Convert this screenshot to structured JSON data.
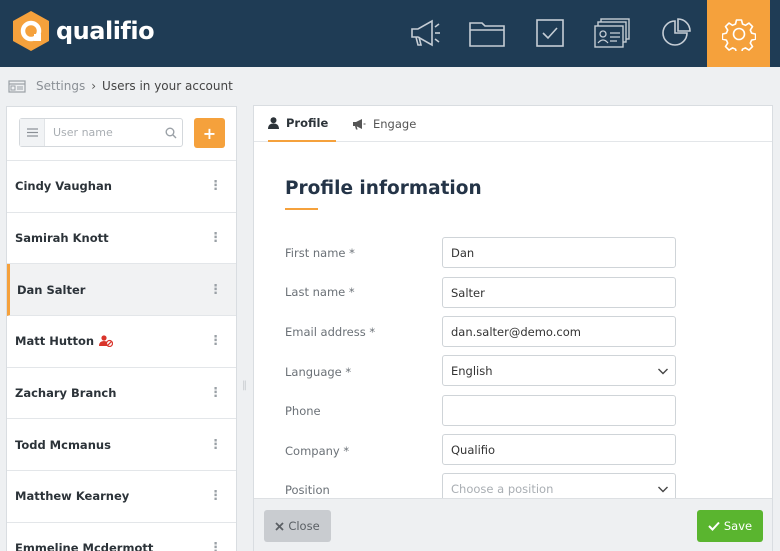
{
  "header": {
    "brand": "qualifio",
    "nav_icons": [
      "megaphone-icon",
      "folder-icon",
      "checkbox-icon",
      "contacts-icon",
      "pie-chart-icon",
      "gear-icon"
    ],
    "accent_color": "#f5a13c",
    "bar_color": "#1f3c55"
  },
  "breadcrumb": {
    "home": "Settings",
    "current": "Users in your account"
  },
  "users": {
    "search_placeholder": "User name",
    "add_label": "+",
    "list": [
      {
        "name": "Cindy Vaughan"
      },
      {
        "name": "Samirah Knott"
      },
      {
        "name": "Dan Salter"
      },
      {
        "name": "Matt Hutton"
      },
      {
        "name": "Zachary Branch"
      },
      {
        "name": "Todd Mcmanus"
      },
      {
        "name": "Matthew Kearney"
      },
      {
        "name": "Emmeline Mcdermott"
      }
    ],
    "selected": "Dan Salter"
  },
  "tabs": [
    {
      "label": "Profile",
      "icon": "user-icon"
    },
    {
      "label": "Engage",
      "icon": "megaphone-icon"
    }
  ],
  "profile": {
    "title": "Profile information",
    "fields": {
      "first_name": {
        "label": "First name *",
        "value": "Dan"
      },
      "last_name": {
        "label": "Last name *",
        "value": "Salter"
      },
      "email": {
        "label": "Email address *",
        "value": "dan.salter@demo.com"
      },
      "language": {
        "label": "Language *",
        "value": "English"
      },
      "phone": {
        "label": "Phone",
        "value": ""
      },
      "company": {
        "label": "Company *",
        "value": "Qualifio"
      },
      "position": {
        "label": "Position",
        "placeholder": "Choose a position"
      }
    }
  },
  "footer": {
    "close_label": "Close",
    "save_label": "Save"
  }
}
